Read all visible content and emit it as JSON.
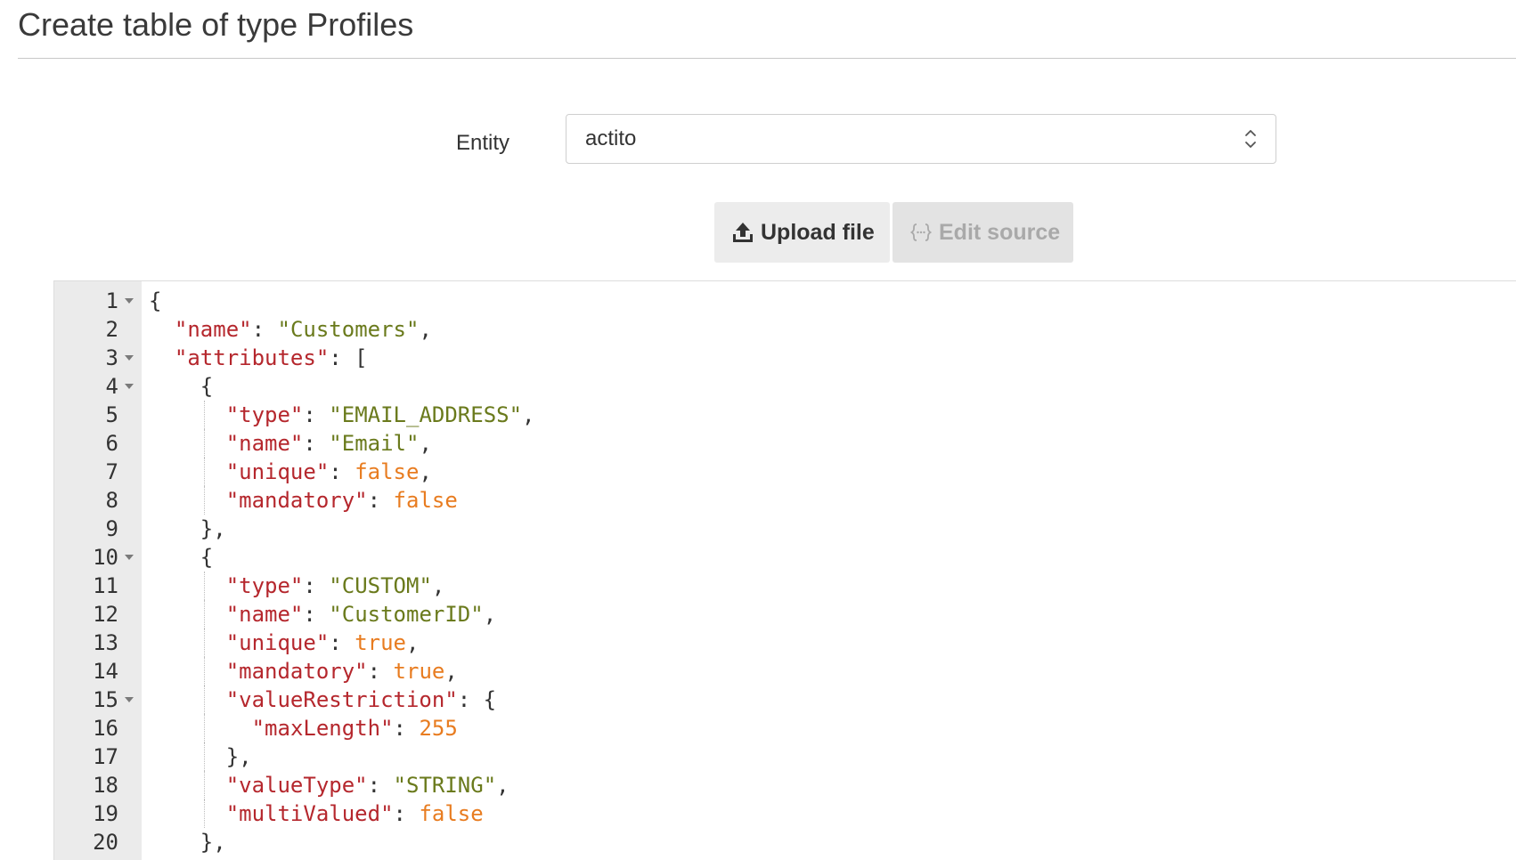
{
  "page": {
    "title": "Create table of type Profiles"
  },
  "form": {
    "entity_label": "Entity",
    "entity_value": "actito"
  },
  "buttons": {
    "upload_label": "Upload file",
    "edit_source_label": "Edit source"
  },
  "editor": {
    "lines": [
      {
        "n": "1",
        "fold": true,
        "indent": 0,
        "guides": 0,
        "tokens": [
          {
            "t": "{",
            "c": "p"
          }
        ]
      },
      {
        "n": "2",
        "fold": false,
        "indent": 1,
        "guides": 0,
        "tokens": [
          {
            "t": "\"name\"",
            "c": "k"
          },
          {
            "t": ": ",
            "c": "p"
          },
          {
            "t": "\"Customers\"",
            "c": "s"
          },
          {
            "t": ",",
            "c": "p"
          }
        ]
      },
      {
        "n": "3",
        "fold": true,
        "indent": 1,
        "guides": 0,
        "tokens": [
          {
            "t": "\"attributes\"",
            "c": "k"
          },
          {
            "t": ": [",
            "c": "p"
          }
        ]
      },
      {
        "n": "4",
        "fold": true,
        "indent": 2,
        "guides": 0,
        "tokens": [
          {
            "t": "{",
            "c": "p"
          }
        ]
      },
      {
        "n": "5",
        "fold": false,
        "indent": 3,
        "guides": 1,
        "tokens": [
          {
            "t": "\"type\"",
            "c": "k"
          },
          {
            "t": ": ",
            "c": "p"
          },
          {
            "t": "\"EMAIL_ADDRESS\"",
            "c": "s"
          },
          {
            "t": ",",
            "c": "p"
          }
        ]
      },
      {
        "n": "6",
        "fold": false,
        "indent": 3,
        "guides": 1,
        "tokens": [
          {
            "t": "\"name\"",
            "c": "k"
          },
          {
            "t": ": ",
            "c": "p"
          },
          {
            "t": "\"Email\"",
            "c": "s"
          },
          {
            "t": ",",
            "c": "p"
          }
        ]
      },
      {
        "n": "7",
        "fold": false,
        "indent": 3,
        "guides": 1,
        "tokens": [
          {
            "t": "\"unique\"",
            "c": "k"
          },
          {
            "t": ": ",
            "c": "p"
          },
          {
            "t": "false",
            "c": "c"
          },
          {
            "t": ",",
            "c": "p"
          }
        ]
      },
      {
        "n": "8",
        "fold": false,
        "indent": 3,
        "guides": 1,
        "tokens": [
          {
            "t": "\"mandatory\"",
            "c": "k"
          },
          {
            "t": ": ",
            "c": "p"
          },
          {
            "t": "false",
            "c": "c"
          }
        ]
      },
      {
        "n": "9",
        "fold": false,
        "indent": 2,
        "guides": 0,
        "tokens": [
          {
            "t": "},",
            "c": "p"
          }
        ]
      },
      {
        "n": "10",
        "fold": true,
        "indent": 2,
        "guides": 0,
        "tokens": [
          {
            "t": "{",
            "c": "p"
          }
        ]
      },
      {
        "n": "11",
        "fold": false,
        "indent": 3,
        "guides": 1,
        "tokens": [
          {
            "t": "\"type\"",
            "c": "k"
          },
          {
            "t": ": ",
            "c": "p"
          },
          {
            "t": "\"CUSTOM\"",
            "c": "s"
          },
          {
            "t": ",",
            "c": "p"
          }
        ]
      },
      {
        "n": "12",
        "fold": false,
        "indent": 3,
        "guides": 1,
        "tokens": [
          {
            "t": "\"name\"",
            "c": "k"
          },
          {
            "t": ": ",
            "c": "p"
          },
          {
            "t": "\"CustomerID\"",
            "c": "s"
          },
          {
            "t": ",",
            "c": "p"
          }
        ]
      },
      {
        "n": "13",
        "fold": false,
        "indent": 3,
        "guides": 1,
        "tokens": [
          {
            "t": "\"unique\"",
            "c": "k"
          },
          {
            "t": ": ",
            "c": "p"
          },
          {
            "t": "true",
            "c": "c"
          },
          {
            "t": ",",
            "c": "p"
          }
        ]
      },
      {
        "n": "14",
        "fold": false,
        "indent": 3,
        "guides": 1,
        "tokens": [
          {
            "t": "\"mandatory\"",
            "c": "k"
          },
          {
            "t": ": ",
            "c": "p"
          },
          {
            "t": "true",
            "c": "c"
          },
          {
            "t": ",",
            "c": "p"
          }
        ]
      },
      {
        "n": "15",
        "fold": true,
        "indent": 3,
        "guides": 1,
        "tokens": [
          {
            "t": "\"valueRestriction\"",
            "c": "k"
          },
          {
            "t": ": {",
            "c": "p"
          }
        ]
      },
      {
        "n": "16",
        "fold": false,
        "indent": 4,
        "guides": 1,
        "tokens": [
          {
            "t": "\"maxLength\"",
            "c": "k"
          },
          {
            "t": ": ",
            "c": "p"
          },
          {
            "t": "255",
            "c": "c"
          }
        ]
      },
      {
        "n": "17",
        "fold": false,
        "indent": 3,
        "guides": 1,
        "tokens": [
          {
            "t": "},",
            "c": "p"
          }
        ]
      },
      {
        "n": "18",
        "fold": false,
        "indent": 3,
        "guides": 1,
        "tokens": [
          {
            "t": "\"valueType\"",
            "c": "k"
          },
          {
            "t": ": ",
            "c": "p"
          },
          {
            "t": "\"STRING\"",
            "c": "s"
          },
          {
            "t": ",",
            "c": "p"
          }
        ]
      },
      {
        "n": "19",
        "fold": false,
        "indent": 3,
        "guides": 1,
        "tokens": [
          {
            "t": "\"multiValued\"",
            "c": "k"
          },
          {
            "t": ": ",
            "c": "p"
          },
          {
            "t": "false",
            "c": "c"
          }
        ]
      },
      {
        "n": "20",
        "fold": false,
        "indent": 2,
        "guides": 0,
        "tokens": [
          {
            "t": "},",
            "c": "p"
          }
        ]
      }
    ]
  },
  "colors": {
    "key": "#b5272d",
    "string": "#6a7a1c",
    "constant": "#e87c20",
    "gutter": "#ebebeb",
    "button_bg": "#ececec",
    "button_disabled_text": "#a9a9a9"
  },
  "icons": {
    "select": "chevron-up-down-icon",
    "upload": "upload-icon",
    "edit_source": "code-braces-icon",
    "fold": "fold-caret-icon"
  }
}
